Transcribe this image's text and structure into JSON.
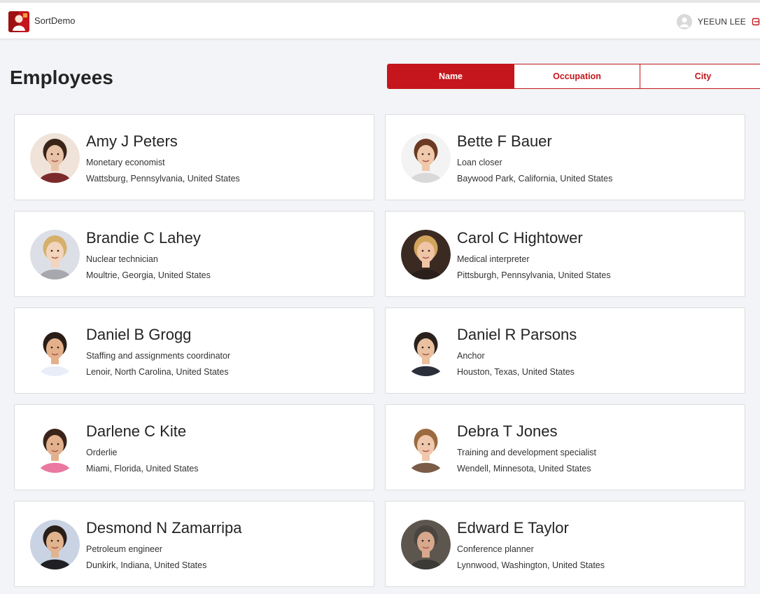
{
  "app": {
    "name": "SortDemo",
    "user": "YEEUN LEE",
    "accent_color": "#c4161c"
  },
  "page": {
    "title": "Employees"
  },
  "sort": {
    "options": [
      "Name",
      "Occupation",
      "City"
    ],
    "selected": "Name"
  },
  "employees": [
    {
      "name": "Amy J Peters",
      "occupation": "Monetary economist",
      "city": "Wattsburg, Pennsylvania, United States",
      "avatar": {
        "bg": "#efe3da",
        "hair": "#3a2418",
        "skin": "#e9c3a7",
        "shirt": "#7a2a2a"
      }
    },
    {
      "name": "Bette F Bauer",
      "occupation": "Loan closer",
      "city": "Baywood Park, California, United States",
      "avatar": {
        "bg": "#f3f3f3",
        "hair": "#6a3a22",
        "skin": "#f0c9ac",
        "shirt": "#d9d9d9"
      }
    },
    {
      "name": "Brandie C Lahey",
      "occupation": "Nuclear technician",
      "city": "Moultrie, Georgia, United States",
      "avatar": {
        "bg": "#dcdfe6",
        "hair": "#d6b06a",
        "skin": "#f3d4bd",
        "shirt": "#a7a8ad"
      }
    },
    {
      "name": "Carol C Hightower",
      "occupation": "Medical interpreter",
      "city": "Pittsburgh, Pennsylvania, United States",
      "avatar": {
        "bg": "#3b2a22",
        "hair": "#d1a45c",
        "skin": "#efc5a5",
        "shirt": "#2a1f1b"
      }
    },
    {
      "name": "Daniel B Grogg",
      "occupation": "Staffing and assignments coordinator",
      "city": "Lenoir, North Carolina, United States",
      "avatar": {
        "bg": "#ffffff",
        "hair": "#2a1d16",
        "skin": "#e4b08c",
        "shirt": "#e8eef7"
      }
    },
    {
      "name": "Daniel R Parsons",
      "occupation": "Anchor",
      "city": "Houston, Texas, United States",
      "avatar": {
        "bg": "#ffffff",
        "hair": "#2b211c",
        "skin": "#e9c0a0",
        "shirt": "#2b2f3a"
      }
    },
    {
      "name": "Darlene C Kite",
      "occupation": "Orderlie",
      "city": "Miami, Florida, United States",
      "avatar": {
        "bg": "#ffffff",
        "hair": "#3a2419",
        "skin": "#e3b18e",
        "shirt": "#ea78a0"
      }
    },
    {
      "name": "Debra T Jones",
      "occupation": "Training and development specialist",
      "city": "Wendell, Minnesota, United States",
      "avatar": {
        "bg": "#ffffff",
        "hair": "#9b6a3e",
        "skin": "#f0c8ad",
        "shirt": "#7b5c48"
      }
    },
    {
      "name": "Desmond N Zamarripa",
      "occupation": "Petroleum engineer",
      "city": "Dunkirk, Indiana, United States",
      "avatar": {
        "bg": "#c9d3e3",
        "hair": "#2a1e18",
        "skin": "#e1b48f",
        "shirt": "#1f1f24"
      }
    },
    {
      "name": "Edward E Taylor",
      "occupation": "Conference planner",
      "city": "Lynnwood, Washington, United States",
      "avatar": {
        "bg": "#5c564f",
        "hair": "#4b4540",
        "skin": "#d7a88c",
        "shirt": "#3b3a36"
      }
    }
  ]
}
